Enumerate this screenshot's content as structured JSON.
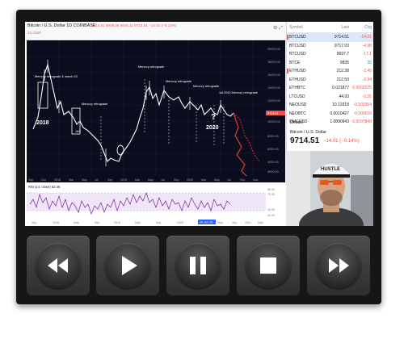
{
  "chart_header": {
    "symbol_title": "Bitcoin / U.S. Dollar  1D  COINBASE",
    "ohlc": "9714.51  9808.05  9646.11  9714.51  −14.01 (−0.14%)",
    "sub_price": "14.4100"
  },
  "annotations": {
    "year_2018": "2018",
    "year_2020": "2020",
    "question_mark": "?",
    "mercury_1": "Mercury retrograde & march 23",
    "mercury_2": "Mercury retrograde",
    "mercury_3": "Mercury retrograde",
    "mercury_4": "Mercury retrograde",
    "mercury_5": "Mercury retrograde",
    "mercury_6": "1st 2020 Mercury retrograde",
    "jan_label": "JAN"
  },
  "price_scale": {
    "labels": [
      "20000.00",
      "18000.00",
      "16000.00",
      "14000.00",
      "12000.00",
      "10000.00",
      "8000.00",
      "6000.00",
      "4000.00",
      "3000.00"
    ],
    "current_price_tag": "9714.51"
  },
  "time_axis": {
    "labels": [
      "Sep",
      "Oct",
      "2018",
      "Mar",
      "May",
      "Jul",
      "Sep",
      "2019",
      "Mar",
      "May",
      "Jul",
      "Sep",
      "2020",
      "Mar",
      "May",
      "Jul",
      "Sep",
      "Nov"
    ]
  },
  "rsi": {
    "title": "RSI (14, close)  52.46",
    "levels": [
      "80.00",
      "70.00",
      "30.00",
      "20.00"
    ]
  },
  "rsi_time_axis": {
    "labels": [
      "Sep",
      "2018",
      "May",
      "Sep",
      "2019",
      "May",
      "Sep",
      "2020",
      "May",
      "Sep",
      "2021",
      "May"
    ],
    "current_date_tag": "04 Jan '20"
  },
  "watchlist": {
    "headers": {
      "symbol": "Symbol",
      "last": "Last",
      "chg": "Chg"
    },
    "rows": [
      {
        "symbol": "BTCUSD",
        "last": "9714.51",
        "chg": "-14.01",
        "dir": "neg",
        "selected": true,
        "flag": true
      },
      {
        "symbol": "BTCUSD",
        "last": "9717.03",
        "chg": "-4.98",
        "dir": "neg",
        "selected": false,
        "flag": false
      },
      {
        "symbol": "BTCUSD",
        "last": "9697.7",
        "chg": "-17.1",
        "dir": "neg",
        "selected": false,
        "flag": false
      },
      {
        "symbol": "BTCE",
        "last": "9835",
        "chg": "35",
        "dir": "pos",
        "selected": false,
        "flag": false
      },
      {
        "symbol": "ETHUSD",
        "last": "212.38",
        "chg": "-2.45",
        "dir": "neg",
        "selected": false,
        "flag": true
      },
      {
        "symbol": "ETHUSD",
        "last": "212.50",
        "chg": "-2.34",
        "dir": "neg",
        "selected": false,
        "flag": false
      },
      {
        "symbol": "ETHBTC",
        "last": "0.021877",
        "chg": "-0.0002025",
        "dir": "neg",
        "selected": false,
        "flag": false
      },
      {
        "symbol": "LTCUSD",
        "last": "44.93",
        "chg": "-0.35",
        "dir": "neg",
        "selected": false,
        "flag": false
      },
      {
        "symbol": "NEOUSD",
        "last": "10.13318",
        "chg": "-0.103304",
        "dir": "neg",
        "selected": false,
        "flag": false
      },
      {
        "symbol": "NEOBTC",
        "last": "0.0010427",
        "chg": "-0.000016",
        "dir": "neg",
        "selected": false,
        "flag": false
      },
      {
        "symbol": "OMGUSD",
        "last": "1.0890943",
        "chg": "-0.0097848",
        "dir": "neg",
        "selected": false,
        "flag": false
      }
    ]
  },
  "details": {
    "label": "Details",
    "name": "Bitcoin / U.S. Dollar",
    "price": "9714.51",
    "change": "−14.01 (−0.14%)"
  },
  "webcam": {
    "hat_text": "HUSTLE"
  },
  "controls": {
    "buttons": [
      {
        "name": "rewind",
        "icon": "rewind-icon"
      },
      {
        "name": "play",
        "icon": "play-icon"
      },
      {
        "name": "pause",
        "icon": "pause-icon"
      },
      {
        "name": "stop",
        "icon": "stop-icon"
      },
      {
        "name": "fast-forward",
        "icon": "fast-forward-icon"
      }
    ]
  },
  "colors": {
    "chart_bg": "#0b0d1f",
    "candle_up": "#ffffff",
    "candle_down": "#222222",
    "projection_red": "#e53935",
    "rsi_line": "#7b1fa2",
    "accent_blue": "#2962ff"
  }
}
